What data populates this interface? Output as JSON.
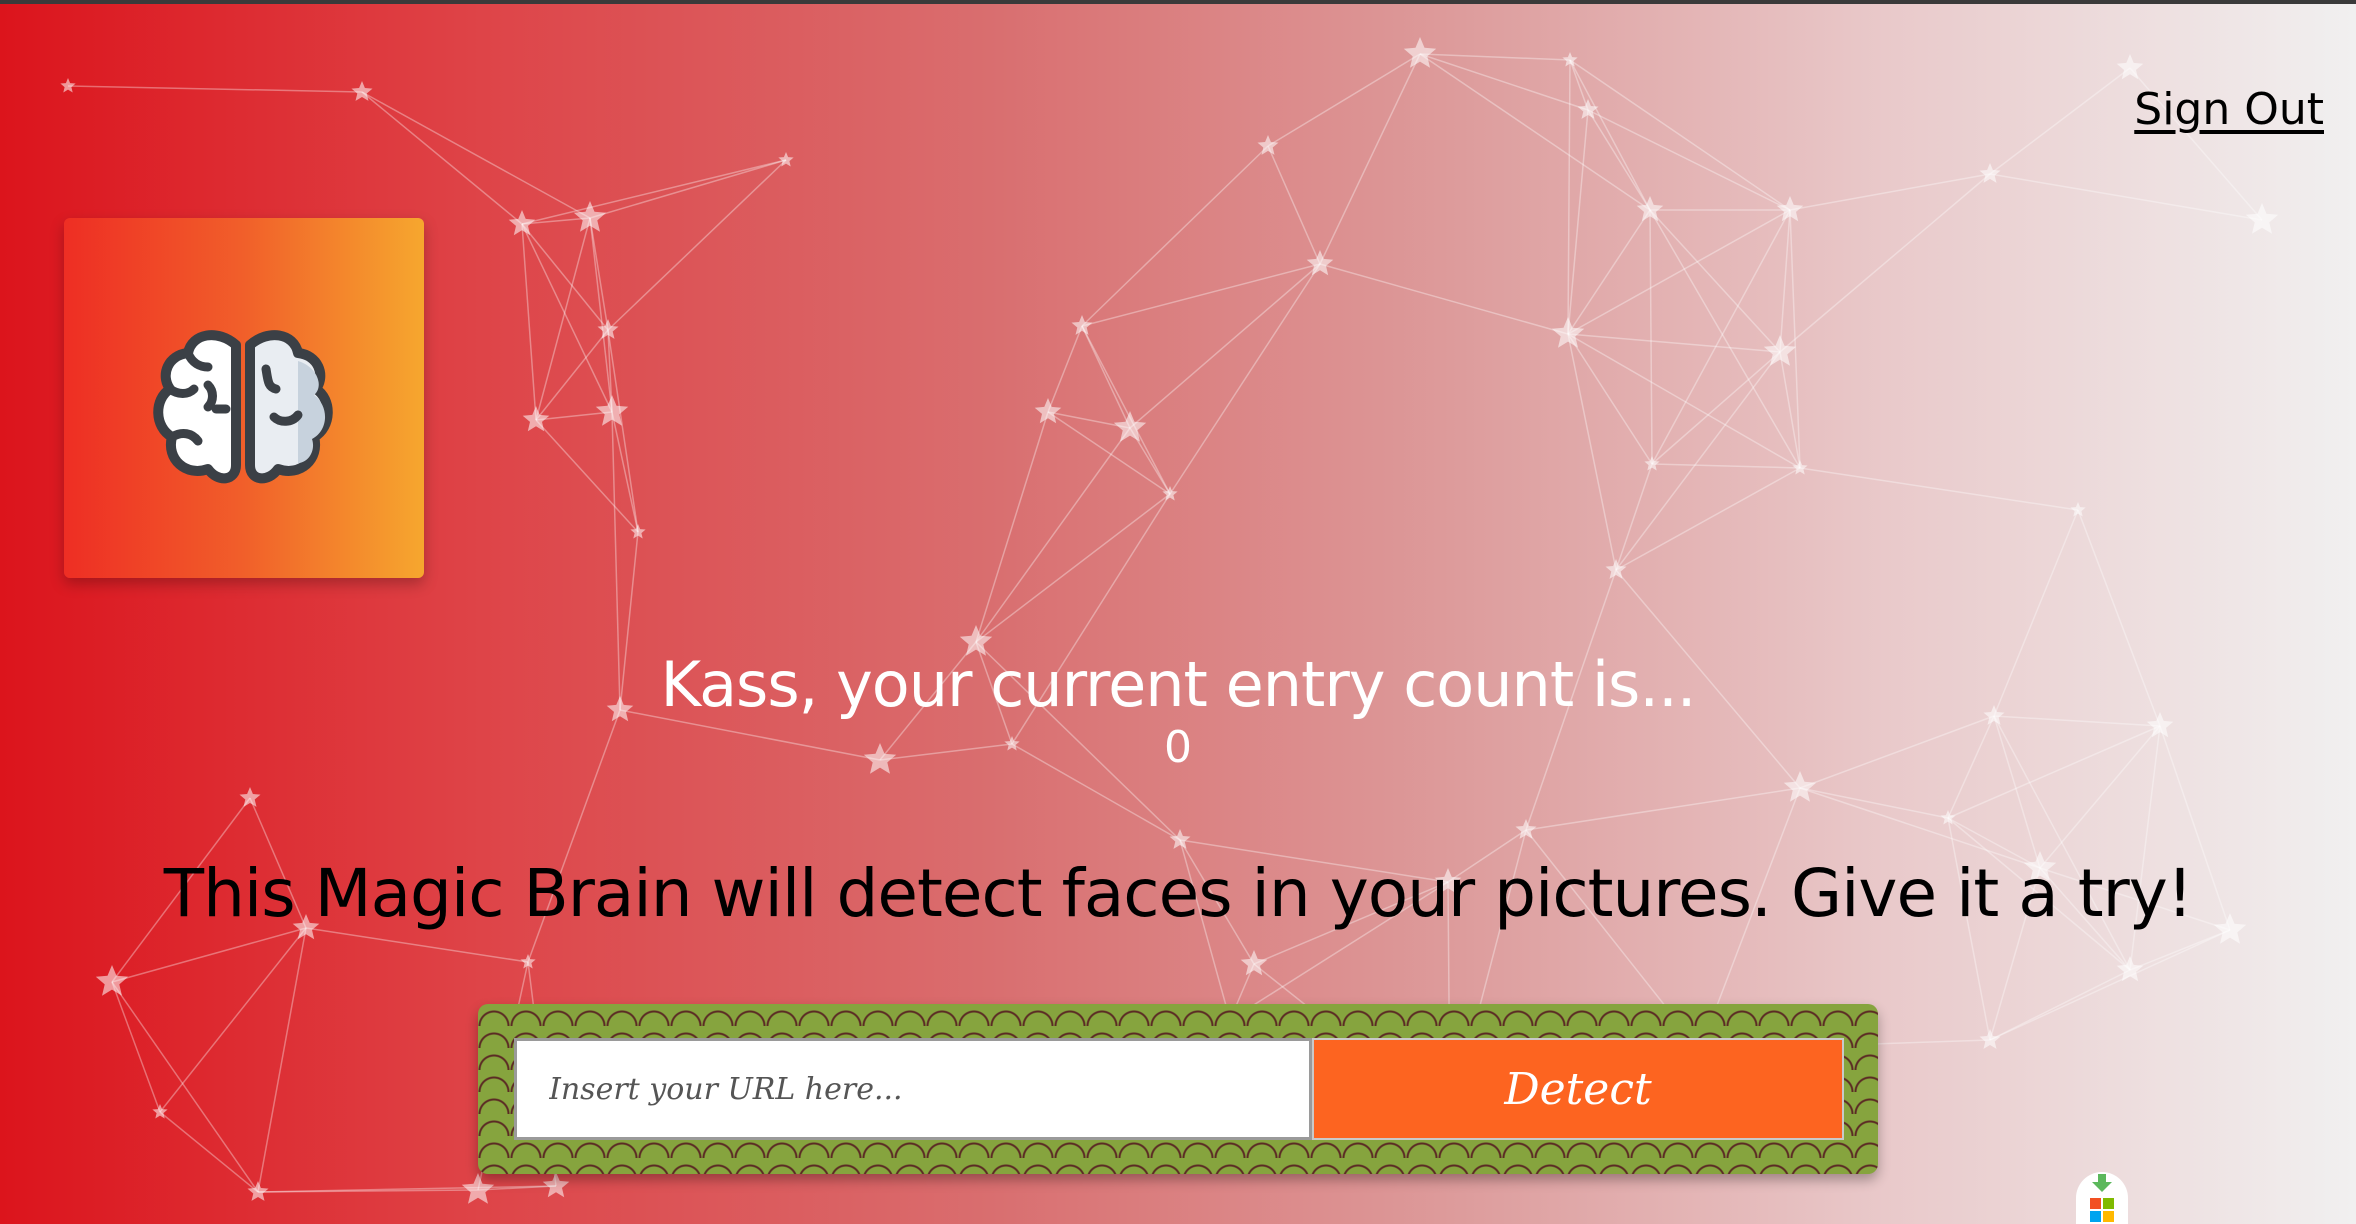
{
  "header": {
    "sign_out_label": "Sign Out"
  },
  "logo": {
    "icon": "brain-icon",
    "colors": {
      "gradient_start": "#ee2e24",
      "gradient_end": "#f6a72e"
    }
  },
  "entries": {
    "greeting": "Kass, your current entry count is...",
    "count": "0"
  },
  "intro": {
    "text": "This Magic Brain will detect faces in your pictures. Give it a try!"
  },
  "form": {
    "url_input": {
      "value": "",
      "placeholder": "Insert your URL here..."
    },
    "detect_label": "Detect"
  },
  "theme": {
    "background_start": "#dc141c",
    "background_end": "#f1f0f0",
    "button_color": "#fd6420",
    "panel_color": "#86a43e"
  },
  "extension": {
    "icon": "extension-download-icon"
  }
}
